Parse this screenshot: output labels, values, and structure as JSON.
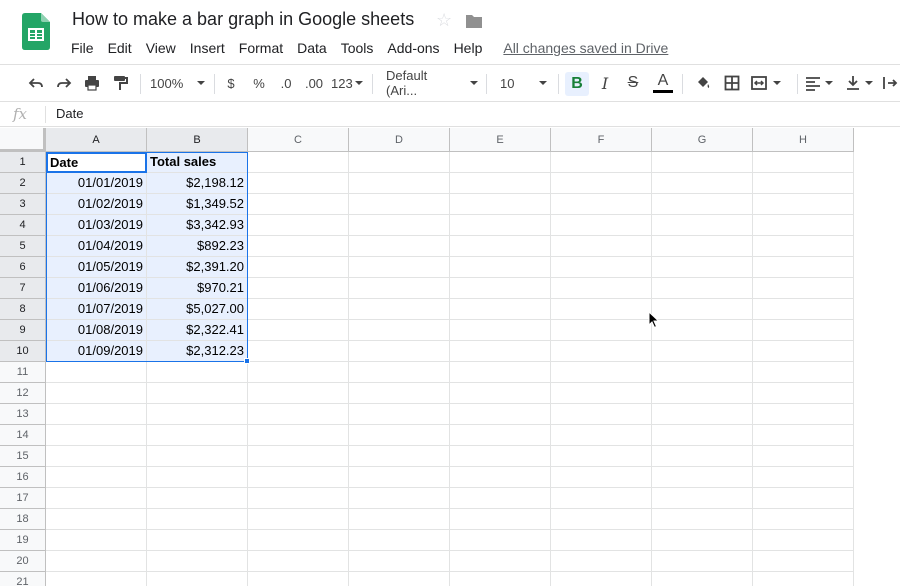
{
  "header": {
    "title": "How to make a bar graph in Google sheets",
    "menu": [
      "File",
      "Edit",
      "View",
      "Insert",
      "Format",
      "Data",
      "Tools",
      "Add-ons",
      "Help"
    ],
    "saved_status": "All changes saved in Drive"
  },
  "toolbar": {
    "zoom": "100%",
    "currency": "$",
    "percent": "%",
    "decrease_decimal": ".0",
    "increase_decimal": ".00",
    "more_formats": "123",
    "font": "Default (Ari...",
    "font_size": "10",
    "bold": "B",
    "italic": "I",
    "strikethrough": "S",
    "text_color_label": "A",
    "text_color": "#000000"
  },
  "formula_bar": {
    "fx": "fx",
    "value": "Date"
  },
  "sheet": {
    "columns": [
      "A",
      "B",
      "C",
      "D",
      "E",
      "F",
      "G",
      "H"
    ],
    "rows": [
      "1",
      "2",
      "3",
      "4",
      "5",
      "6",
      "7",
      "8",
      "9",
      "10",
      "11",
      "12",
      "13",
      "14",
      "15",
      "16",
      "17",
      "18",
      "19",
      "20",
      "21"
    ],
    "header_row": [
      "Date",
      "Total sales"
    ],
    "data": [
      [
        "01/01/2019",
        "$2,198.12"
      ],
      [
        "01/02/2019",
        "$1,349.52"
      ],
      [
        "01/03/2019",
        "$3,342.93"
      ],
      [
        "01/04/2019",
        "$892.23"
      ],
      [
        "01/05/2019",
        "$2,391.20"
      ],
      [
        "01/06/2019",
        "$970.21"
      ],
      [
        "01/07/2019",
        "$5,027.00"
      ],
      [
        "01/08/2019",
        "$2,322.41"
      ],
      [
        "01/09/2019",
        "$2,312.23"
      ]
    ]
  },
  "colors": {
    "accent": "#1a73e8",
    "sheets_green": "#0f9d58",
    "selection_fill": "#e8f0fe"
  }
}
